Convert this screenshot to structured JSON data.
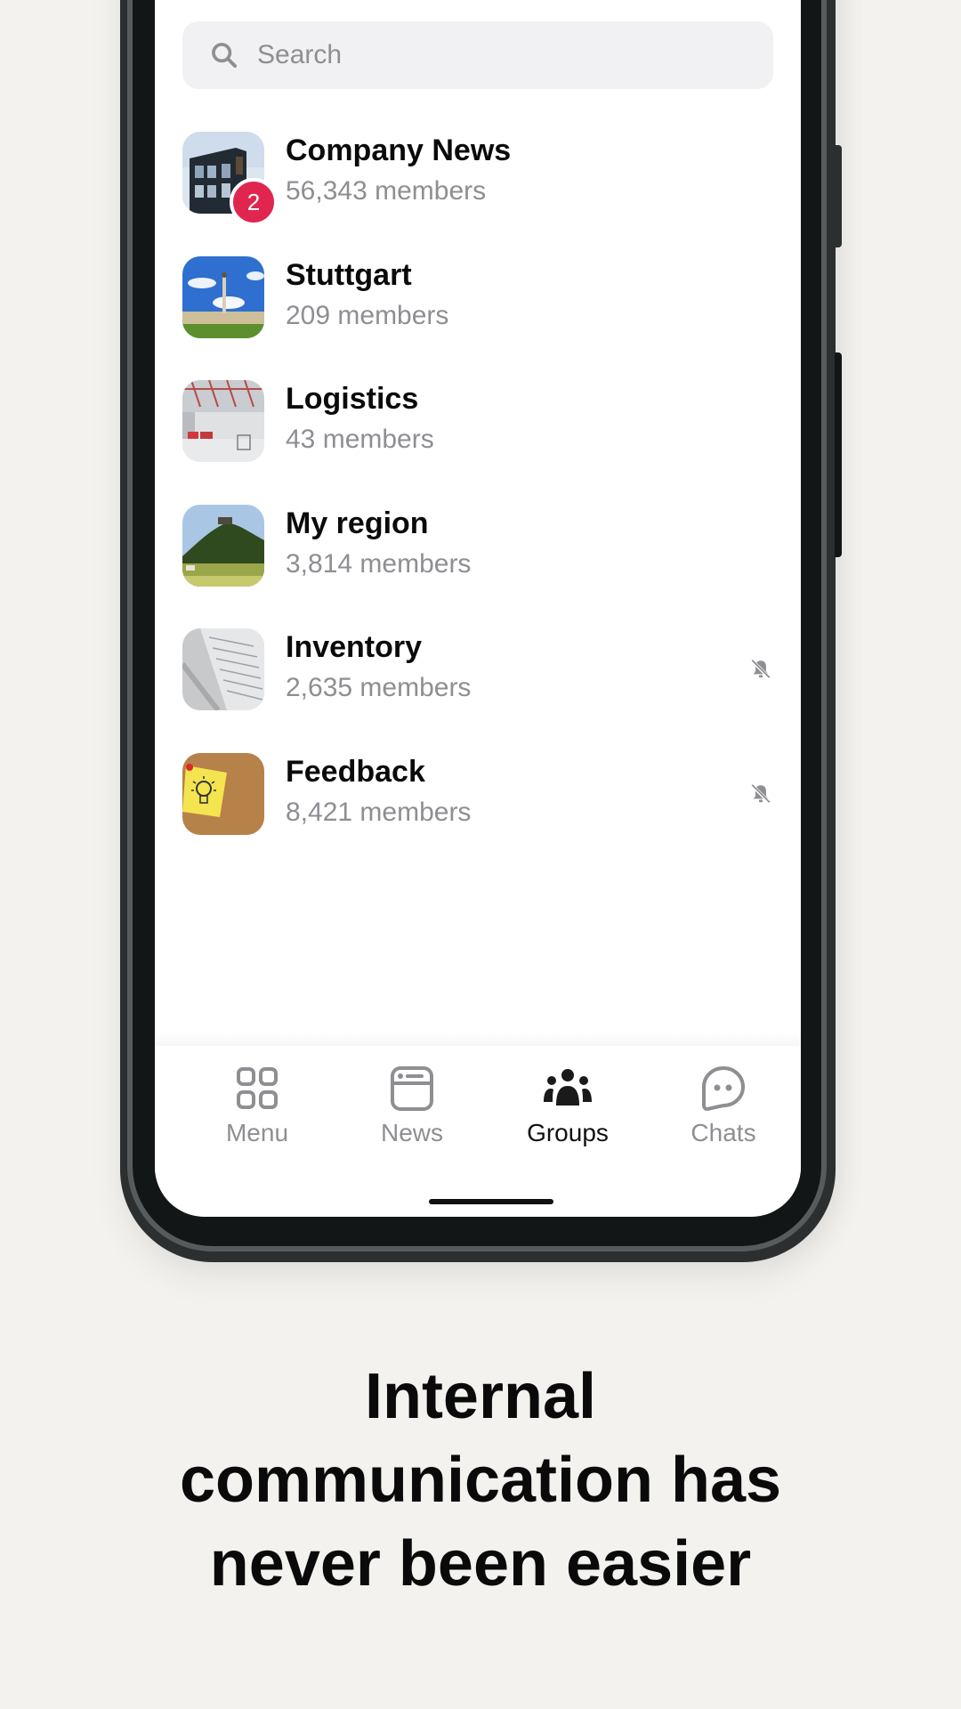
{
  "search": {
    "placeholder": "Search",
    "value": ""
  },
  "groups": [
    {
      "name": "Company News",
      "members": "56,343 members",
      "badge": "2",
      "muted": false,
      "image": "modern-building-photo"
    },
    {
      "name": "Stuttgart",
      "members": "209 members",
      "badge": null,
      "muted": false,
      "image": "stuttgart-square-photo"
    },
    {
      "name": "Logistics",
      "members": "43 members",
      "badge": null,
      "muted": false,
      "image": "warehouse-photo"
    },
    {
      "name": "My region",
      "members": "3,814 members",
      "badge": null,
      "muted": false,
      "image": "hill-landscape-photo"
    },
    {
      "name": "Inventory",
      "members": "2,635 members",
      "badge": null,
      "muted": true,
      "image": "spreadsheet-paper-photo"
    },
    {
      "name": "Feedback",
      "members": "8,421 members",
      "badge": null,
      "muted": true,
      "image": "sticky-note-lightbulb-photo"
    }
  ],
  "tabs": [
    {
      "label": "Menu",
      "icon": "grid-icon",
      "active": false
    },
    {
      "label": "News",
      "icon": "newspaper-icon",
      "active": false
    },
    {
      "label": "Groups",
      "icon": "people-icon",
      "active": true
    },
    {
      "label": "Chats",
      "icon": "chat-bubble-icon",
      "active": false
    }
  ],
  "headline": [
    "Internal",
    "communication has",
    "never been easier"
  ],
  "colors": {
    "badge": "#e0264f",
    "active_tab": "#111111",
    "inactive_tab": "#8e8e93",
    "background": "#f3f2ef"
  }
}
